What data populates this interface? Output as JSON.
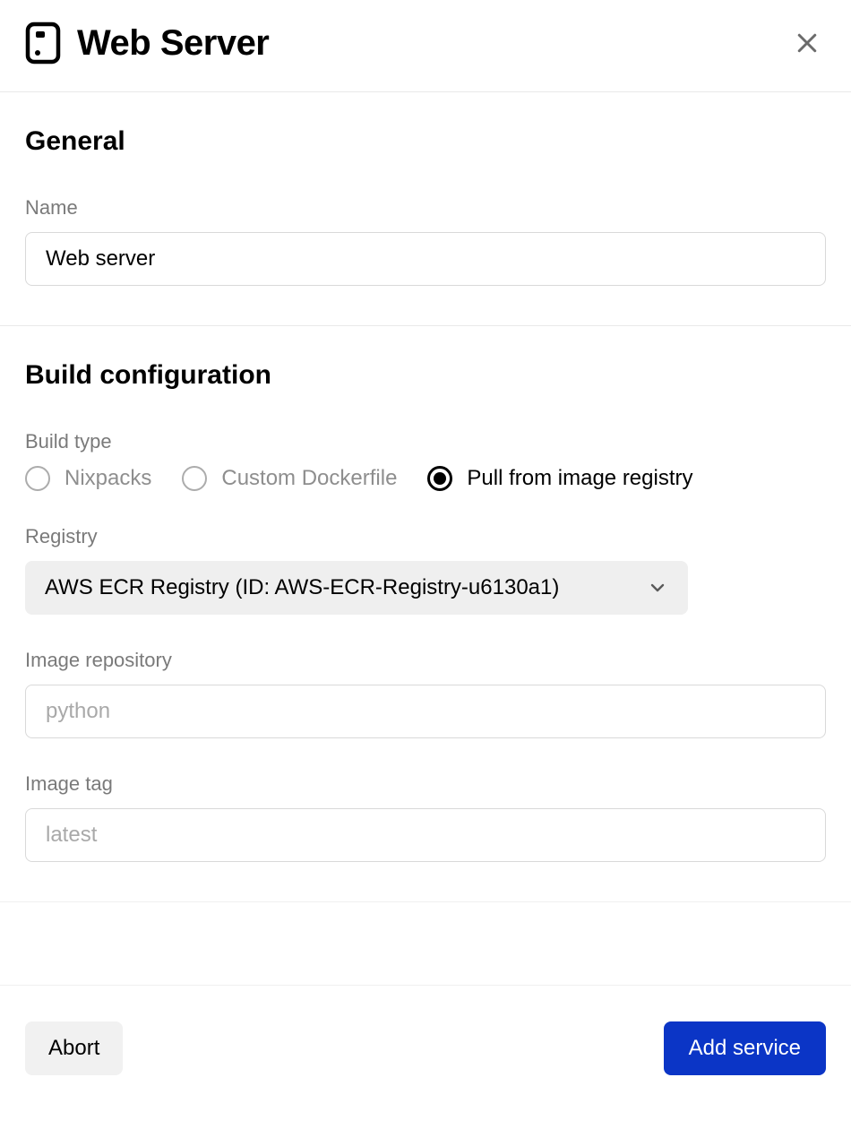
{
  "header": {
    "title": "Web Server"
  },
  "general": {
    "section_title": "General",
    "name_label": "Name",
    "name_value": "Web server"
  },
  "build": {
    "section_title": "Build configuration",
    "build_type_label": "Build type",
    "options": {
      "nixpacks": "Nixpacks",
      "dockerfile": "Custom Dockerfile",
      "registry": "Pull from image registry"
    },
    "selected": "registry",
    "registry_label": "Registry",
    "registry_value": "AWS ECR Registry (ID: AWS-ECR-Registry-u6130a1)",
    "image_repo_label": "Image repository",
    "image_repo_placeholder": "python",
    "image_repo_value": "",
    "image_tag_label": "Image tag",
    "image_tag_placeholder": "latest",
    "image_tag_value": ""
  },
  "footer": {
    "abort_label": "Abort",
    "submit_label": "Add service"
  }
}
